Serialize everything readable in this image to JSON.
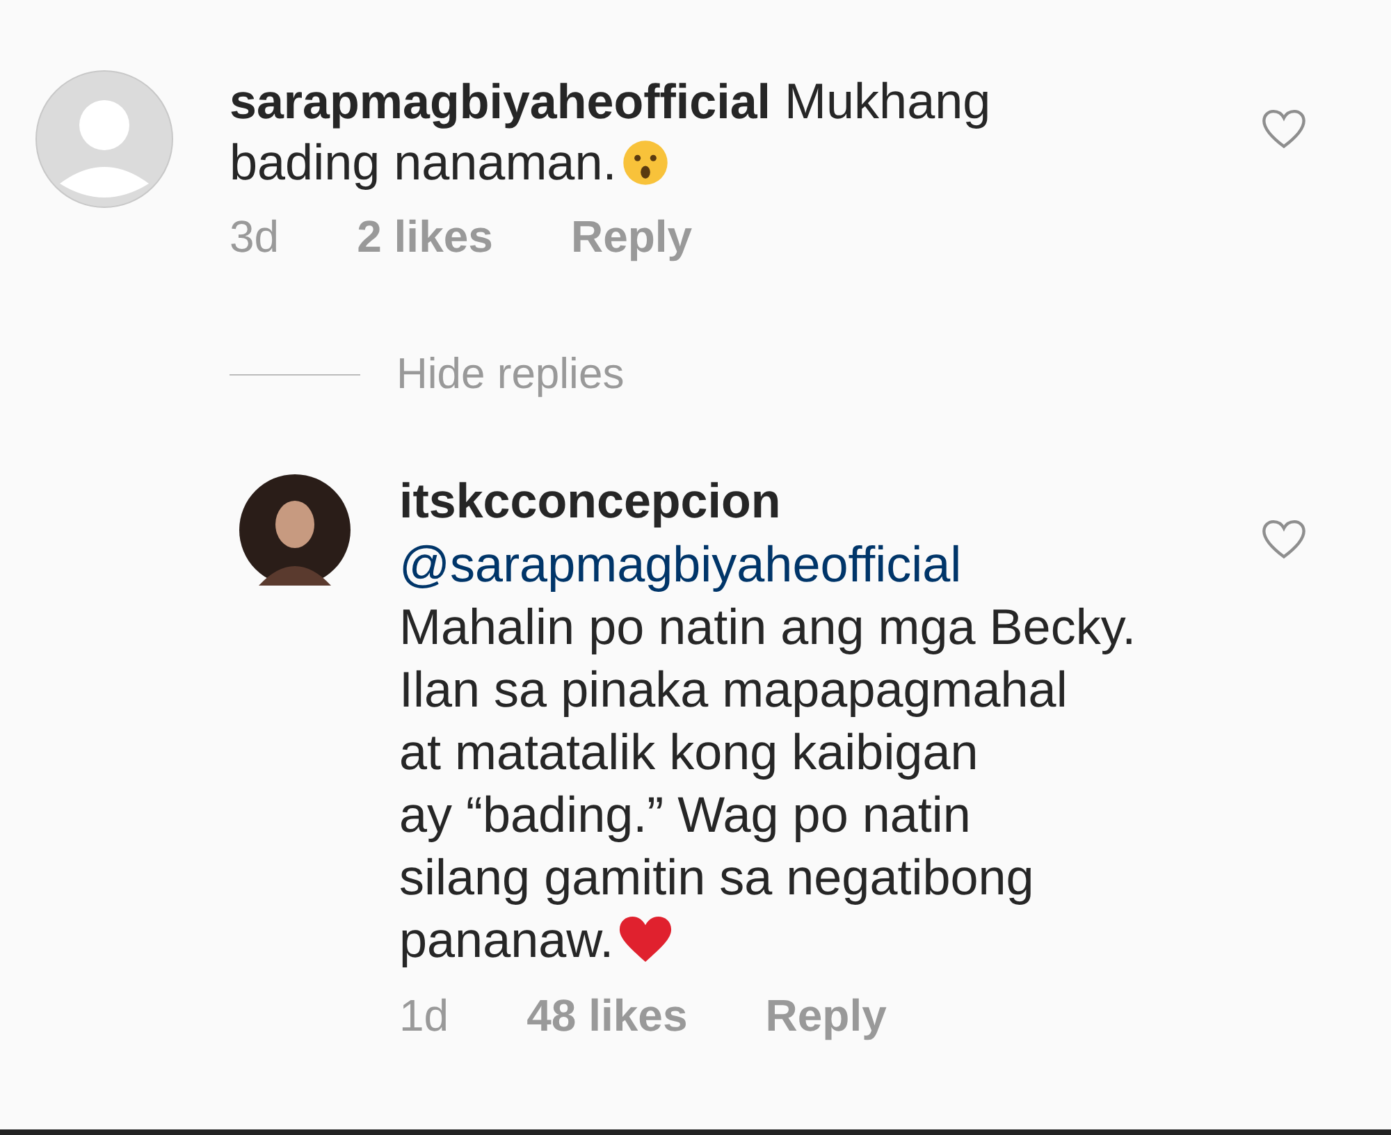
{
  "comments": [
    {
      "kind": "comment",
      "username": "sarapmagbiyaheofficial",
      "text": "Mukhang bading nanaman.",
      "time": "3d",
      "likes": "2 likes",
      "reply": "Reply",
      "liked": false
    },
    {
      "kind": "reply",
      "username": "itskcconcepcion",
      "mention": "@sarapmagbiyaheofficial",
      "text": "Mahalin po natin ang mga Becky.\nIlan sa pinaka mapapagmahal\nat matatalik kong kaibigan\nay “bading.” Wag po natin\nsilang gamitin sa negatibong\npananaw.",
      "time": "1d",
      "likes": "48 likes",
      "reply": "Reply",
      "liked": false
    }
  ],
  "hide_replies": "Hide replies"
}
